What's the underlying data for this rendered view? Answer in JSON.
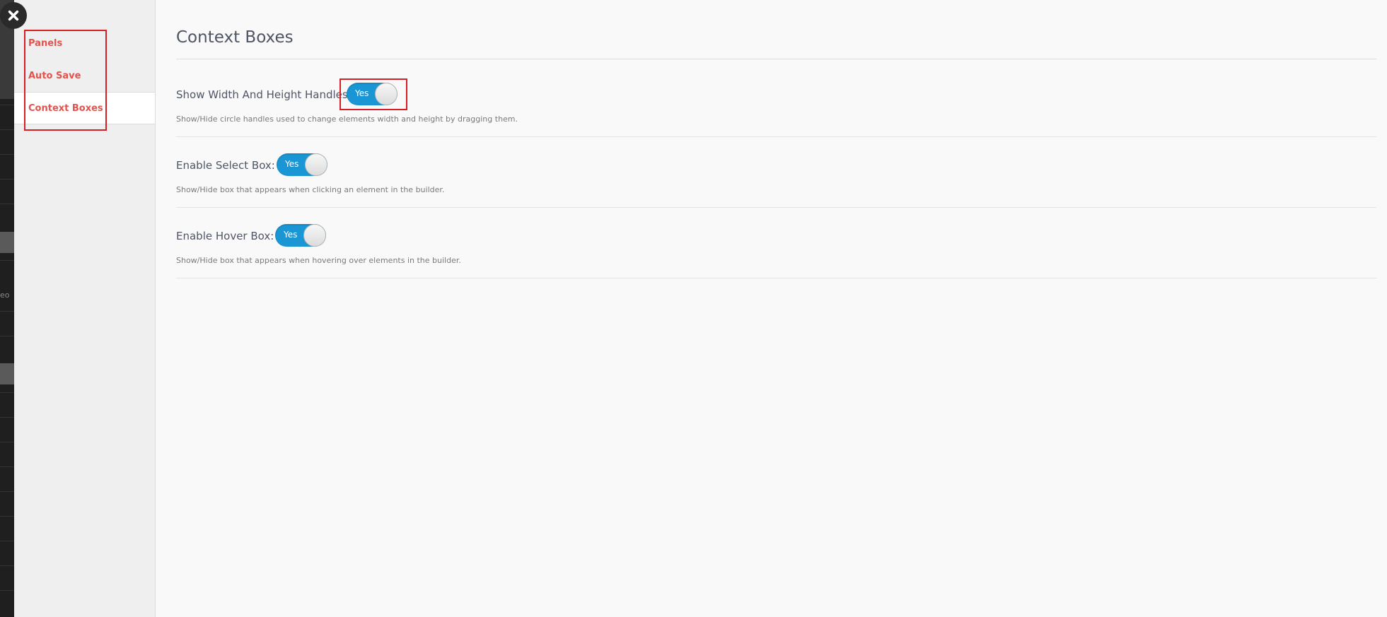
{
  "close_button": {
    "icon": "close-icon"
  },
  "background_app": {
    "partial_text": "eo"
  },
  "sidebar": {
    "items": [
      {
        "label": "Panels",
        "active": false
      },
      {
        "label": "Auto Save",
        "active": false
      },
      {
        "label": "Context Boxes",
        "active": true
      }
    ]
  },
  "main": {
    "title": "Context Boxes",
    "settings": [
      {
        "label": "Show Width And Height Handles:",
        "toggle": "Yes",
        "description": "Show/Hide circle handles used to change elements width and height by dragging them."
      },
      {
        "label": "Enable Select Box:",
        "toggle": "Yes",
        "description": "Show/Hide box that appears when clicking an element in the builder."
      },
      {
        "label": "Enable Hover Box:",
        "toggle": "Yes",
        "description": "Show/Hide box that appears when hovering over elements in the builder."
      }
    ]
  },
  "colors": {
    "accent_red": "#e2534e",
    "toggle_blue": "#1a96d4",
    "highlight_red": "#d91d25"
  }
}
